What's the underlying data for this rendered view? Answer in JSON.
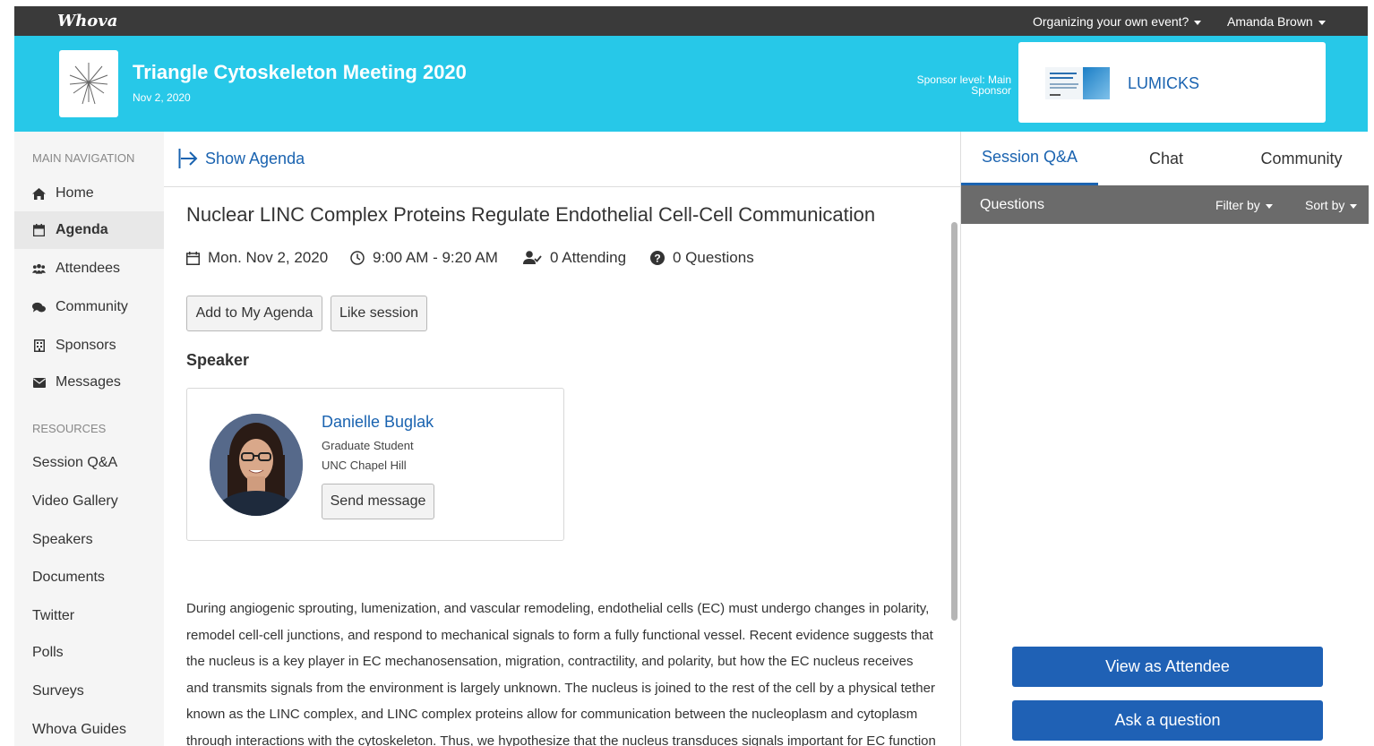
{
  "app": {
    "logo": "Whova"
  },
  "topbar": {
    "organize_link": "Organizing your own event?",
    "user_name": "Amanda Brown"
  },
  "event": {
    "title": "Triangle Cytoskeleton Meeting 2020",
    "date": "Nov 2, 2020",
    "sponsor_level": "Sponsor level: Main Sponsor",
    "sponsor_name": "LUMICKS"
  },
  "sidebar": {
    "main_heading": "MAIN NAVIGATION",
    "main_items": [
      {
        "label": "Home",
        "icon": "home-icon"
      },
      {
        "label": "Agenda",
        "icon": "calendar-icon"
      },
      {
        "label": "Attendees",
        "icon": "users-icon"
      },
      {
        "label": "Community",
        "icon": "chat-bubbles-icon"
      },
      {
        "label": "Sponsors",
        "icon": "building-icon"
      },
      {
        "label": "Messages",
        "icon": "envelope-icon"
      }
    ],
    "resources_heading": "RESOURCES",
    "resource_items": [
      "Session Q&A",
      "Video Gallery",
      "Speakers",
      "Documents",
      "Twitter",
      "Polls",
      "Surveys",
      "Whova Guides"
    ],
    "active_item": "Agenda"
  },
  "main": {
    "show_agenda": "Show Agenda",
    "session_title": "Nuclear LINC Complex Proteins Regulate Endothelial Cell-Cell Communication",
    "date": "Mon. Nov 2, 2020",
    "time": "9:00 AM - 9:20 AM",
    "attending": "0 Attending",
    "questions": "0 Questions",
    "add_to_agenda": "Add to My Agenda",
    "like_session": "Like session",
    "speaker_heading": "Speaker",
    "speaker": {
      "name": "Danielle Buglak",
      "role": "Graduate Student",
      "org": "UNC Chapel Hill",
      "send_message": "Send message"
    },
    "description": "During angiogenic sprouting, lumenization, and vascular remodeling, endothelial cells (EC) must undergo changes in polarity, remodel cell-cell junctions, and respond to mechanical signals to form a fully functional vessel. Recent evidence suggests that the nucleus is a key player in EC mechanosensation, migration, contractility, and polarity, but how the EC nucleus receives and transmits signals from the environment is largely unknown. The nucleus is joined to the rest of the cell by a physical tether known as the LINC complex, and LINC complex proteins allow for communication between the nucleoplasm and cytoplasm through interactions with the cytoskeleton. Thus, we hypothesize that the nucleus transduces signals important for EC function"
  },
  "right_panel": {
    "tabs": [
      "Session Q&A",
      "Chat",
      "Community"
    ],
    "active_tab": "Session Q&A",
    "questions_label": "Questions",
    "filter_by": "Filter by",
    "sort_by": "Sort by",
    "view_as_attendee": "View as Attendee",
    "ask_question": "Ask a question"
  },
  "colors": {
    "header_bg": "#27c8e8",
    "topbar_bg": "#3a3a3a",
    "link_blue": "#1a63b0",
    "button_blue": "#1f61b5"
  }
}
